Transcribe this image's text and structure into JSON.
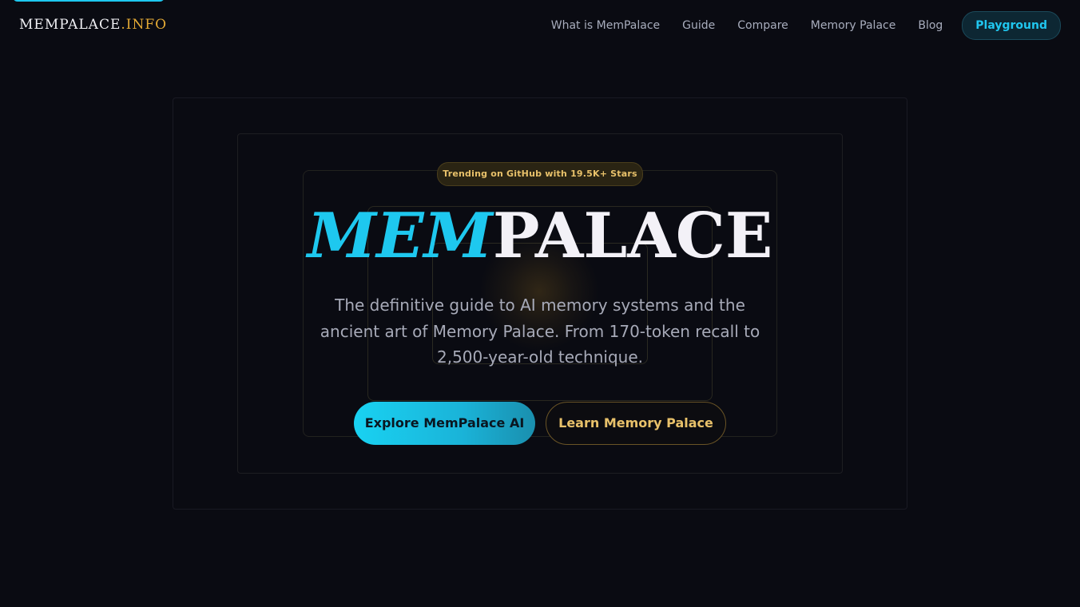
{
  "header": {
    "logo": {
      "main": "MEMPALACE",
      "suffix": ".INFO"
    },
    "nav": [
      {
        "label": "What is MemPalace"
      },
      {
        "label": "Guide"
      },
      {
        "label": "Compare"
      },
      {
        "label": "Memory Palace"
      },
      {
        "label": "Blog"
      }
    ],
    "cta_label": "Playground"
  },
  "hero": {
    "badge": "Trending on GitHub with 19.5K+ Stars",
    "title_part1": "MEM",
    "title_part2": "PALACE",
    "subtitle": "The definitive guide to AI memory systems and the ancient art of Memory Palace. From 170-token recall to 2,500-year-old technique.",
    "primary_button": "Explore MemPalace AI",
    "secondary_button": "Learn Memory Palace"
  },
  "colors": {
    "background": "#0a0b12",
    "accent_cyan": "#1ec8ef",
    "accent_gold": "#e8c16a",
    "logo_suffix": "#e3a935"
  }
}
